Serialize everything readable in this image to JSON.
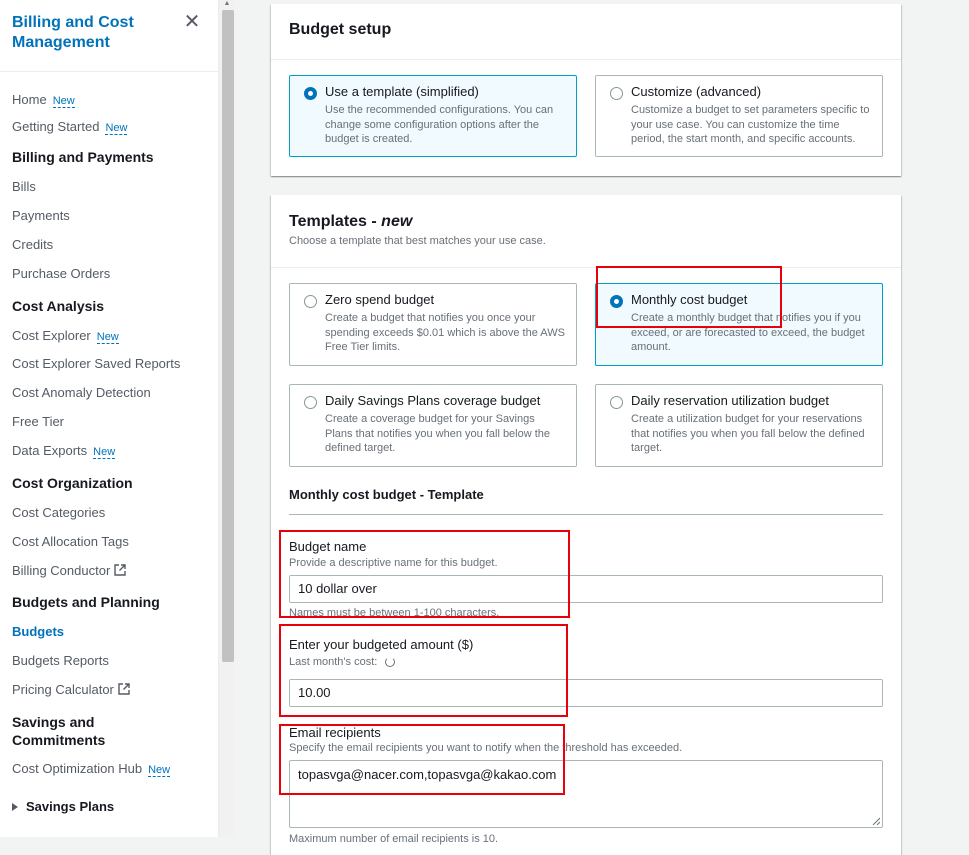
{
  "sidebar": {
    "title": "Billing and Cost Management",
    "new_badge": "New",
    "items": {
      "home": "Home",
      "getting_started": "Getting Started",
      "billing_payments": "Billing and Payments",
      "bills": "Bills",
      "payments": "Payments",
      "credits": "Credits",
      "purchase_orders": "Purchase Orders",
      "cost_analysis": "Cost Analysis",
      "cost_explorer": "Cost Explorer",
      "cost_explorer_saved": "Cost Explorer Saved Reports",
      "cost_anomaly": "Cost Anomaly Detection",
      "free_tier": "Free Tier",
      "data_exports": "Data Exports",
      "cost_organization": "Cost Organization",
      "cost_categories": "Cost Categories",
      "cost_allocation_tags": "Cost Allocation Tags",
      "billing_conductor": "Billing Conductor",
      "budgets_planning": "Budgets and Planning",
      "budgets": "Budgets",
      "budgets_reports": "Budgets Reports",
      "pricing_calculator": "Pricing Calculator",
      "savings_commitments": "Savings and Commitments",
      "cost_optimization_hub": "Cost Optimization Hub",
      "savings_plans": "Savings Plans"
    }
  },
  "budget_setup": {
    "title": "Budget setup",
    "options": [
      {
        "label": "Use a template (simplified)",
        "desc": "Use the recommended configurations. You can change some configuration options after the budget is created."
      },
      {
        "label": "Customize (advanced)",
        "desc": "Customize a budget to set parameters specific to your use case. You can customize the time period, the start month, and specific accounts."
      }
    ]
  },
  "templates": {
    "title": "Templates - ",
    "title_new": "new",
    "description": "Choose a template that best matches your use case.",
    "options": [
      {
        "label": "Zero spend budget",
        "desc": "Create a budget that notifies you once your spending exceeds $0.01 which is above the AWS Free Tier limits."
      },
      {
        "label": "Monthly cost budget",
        "desc": "Create a monthly budget that notifies you if you exceed, or are forecasted to exceed, the budget amount."
      },
      {
        "label": "Daily Savings Plans coverage budget",
        "desc": "Create a coverage budget for your Savings Plans that notifies you when you fall below the defined target."
      },
      {
        "label": "Daily reservation utilization budget",
        "desc": "Create a utilization budget for your reservations that notifies you when you fall below the defined target."
      }
    ]
  },
  "form": {
    "section_title": "Monthly cost budget - Template",
    "budget_name": {
      "label": "Budget name",
      "desc": "Provide a descriptive name for this budget.",
      "value": "10 dollar over",
      "constraint": "Names must be between 1-100 characters."
    },
    "amount": {
      "label": "Enter your budgeted amount ($)",
      "desc": "Last month's cost:",
      "value": "10.00"
    },
    "email": {
      "label": "Email recipients",
      "desc": "Specify the email recipients you want to notify when the threshold has exceeded.",
      "value": "topasvga@nacer.com,topasvga@kakao.com",
      "constraint": "Maximum number of email recipients is 10."
    }
  },
  "colors": {
    "accent": "#0073bb",
    "selected_border": "#00a1c9",
    "highlight": "#e8000b"
  }
}
